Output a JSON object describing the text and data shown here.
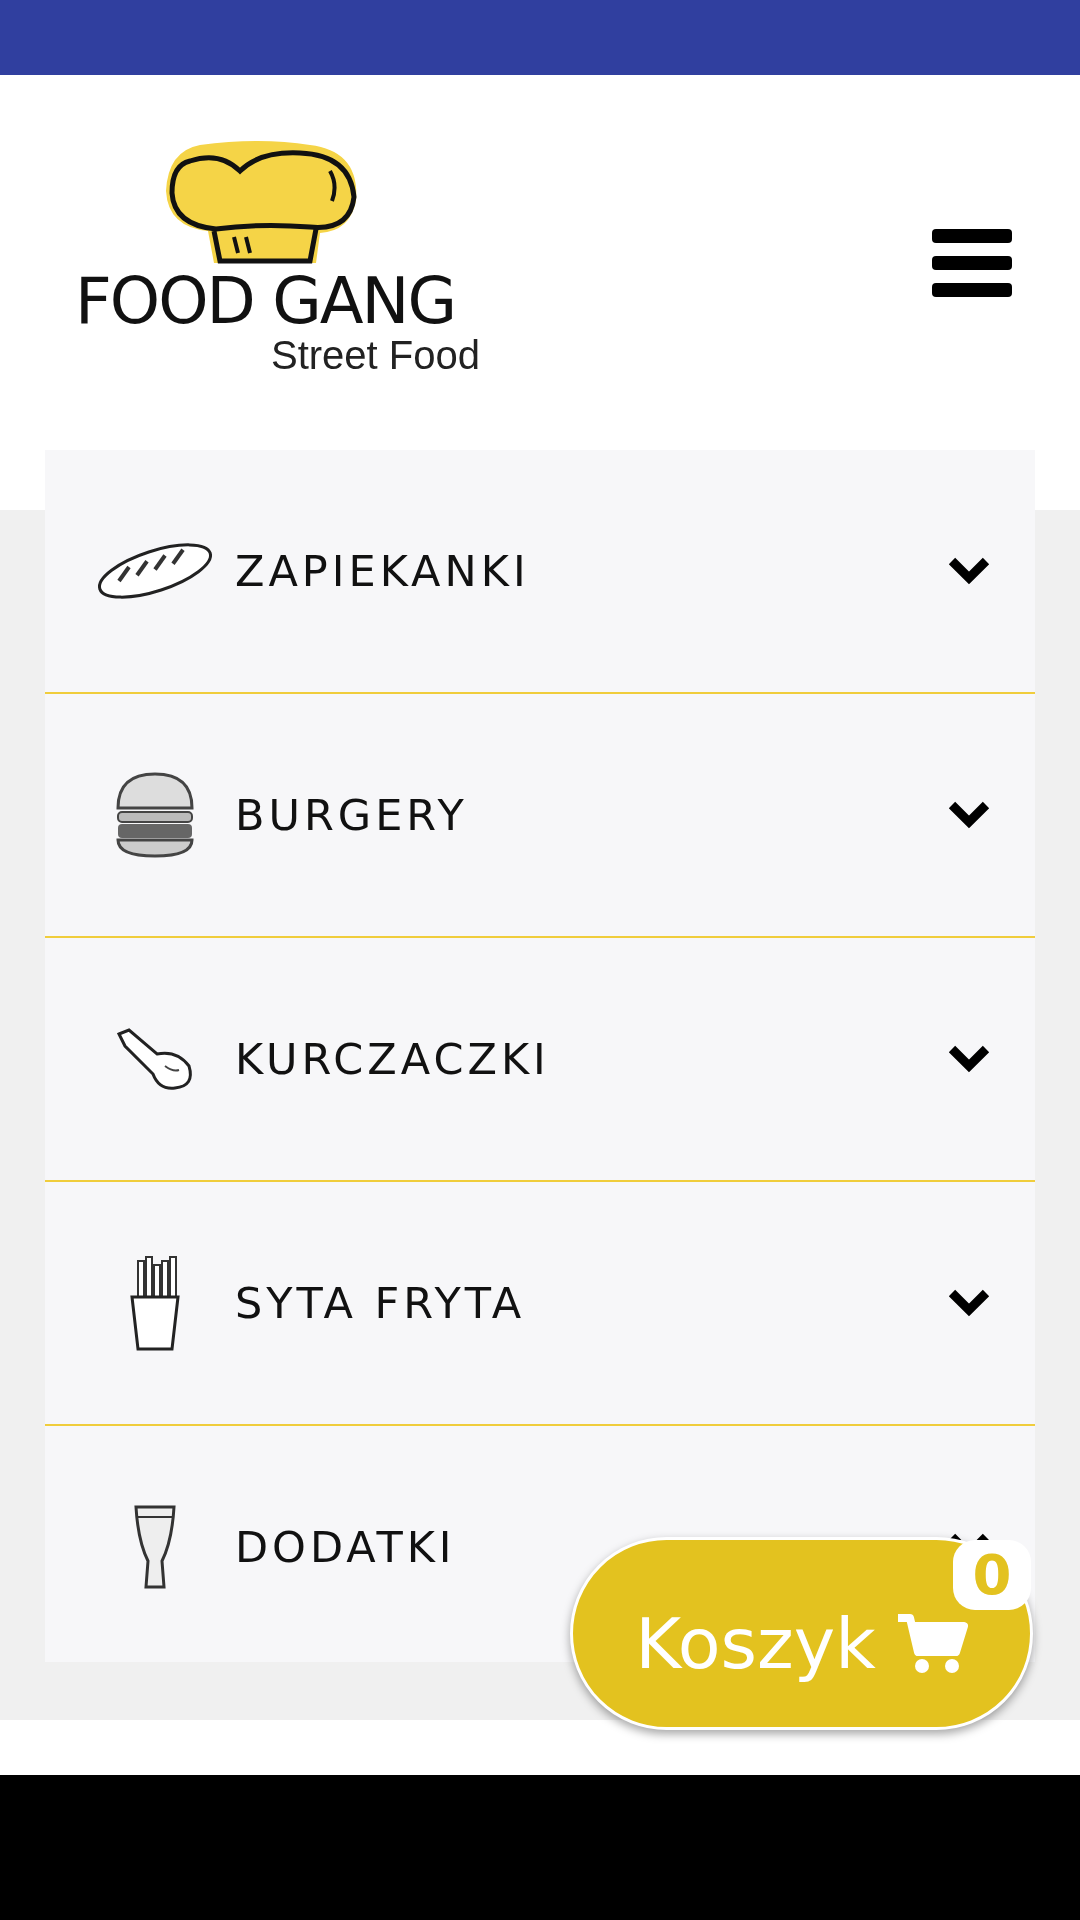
{
  "logo": {
    "title": "FOOD GANG",
    "subtitle": "Street Food"
  },
  "menu": [
    {
      "label": "ZAPIEKANKI",
      "kind": "baguette",
      "expanded": false
    },
    {
      "label": "BURGERY",
      "kind": "burger",
      "expanded": false
    },
    {
      "label": "KURCZACZKI",
      "kind": "drumstick",
      "expanded": false
    },
    {
      "label": "SYTA FRYTA",
      "kind": "fries",
      "expanded": false
    },
    {
      "label": "DODATKI",
      "kind": "beer",
      "expanded": false
    }
  ],
  "cart": {
    "label": "Koszyk",
    "count": "0"
  }
}
